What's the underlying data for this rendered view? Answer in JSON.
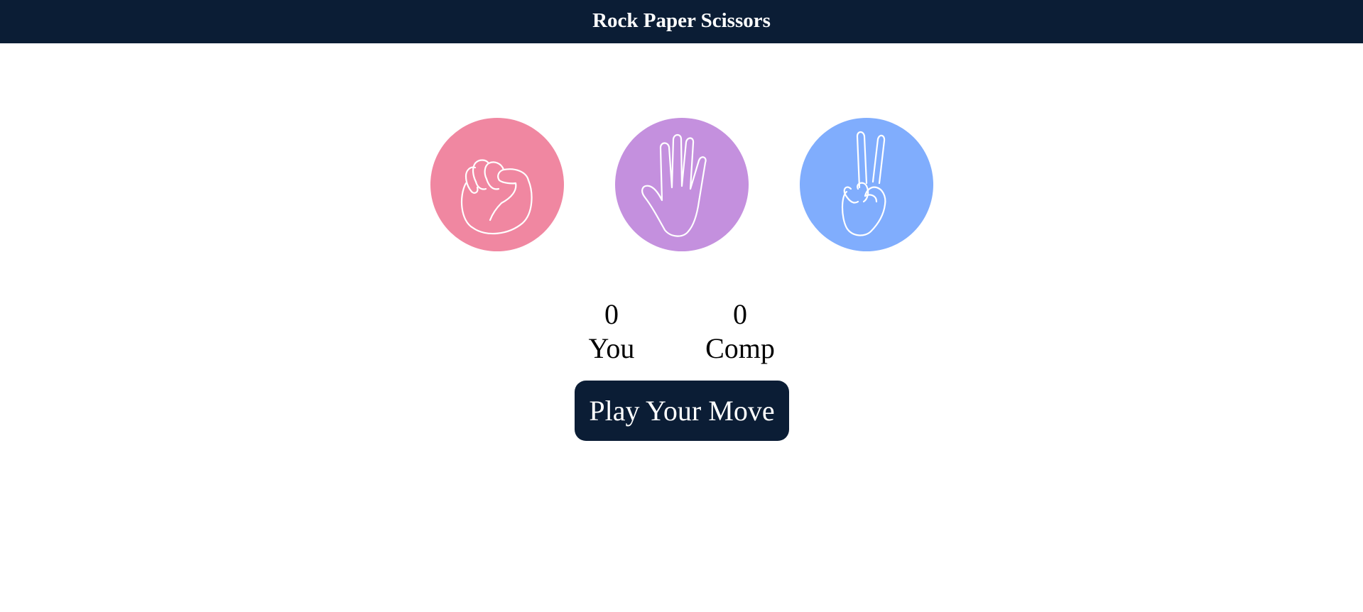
{
  "header": {
    "title": "Rock Paper Scissors",
    "background": "#0b1d35"
  },
  "choices": [
    {
      "name": "rock",
      "icon": "fist-icon",
      "color": "#f087a1"
    },
    {
      "name": "paper",
      "icon": "open-hand-icon",
      "color": "#c490de"
    },
    {
      "name": "scissors",
      "icon": "peace-sign-icon",
      "color": "#80adfd"
    }
  ],
  "scoreboard": {
    "user": {
      "value": "0",
      "label": "You"
    },
    "comp": {
      "value": "0",
      "label": "Comp"
    }
  },
  "play_button": {
    "label": "Play Your Move",
    "background": "#0b1d35"
  }
}
